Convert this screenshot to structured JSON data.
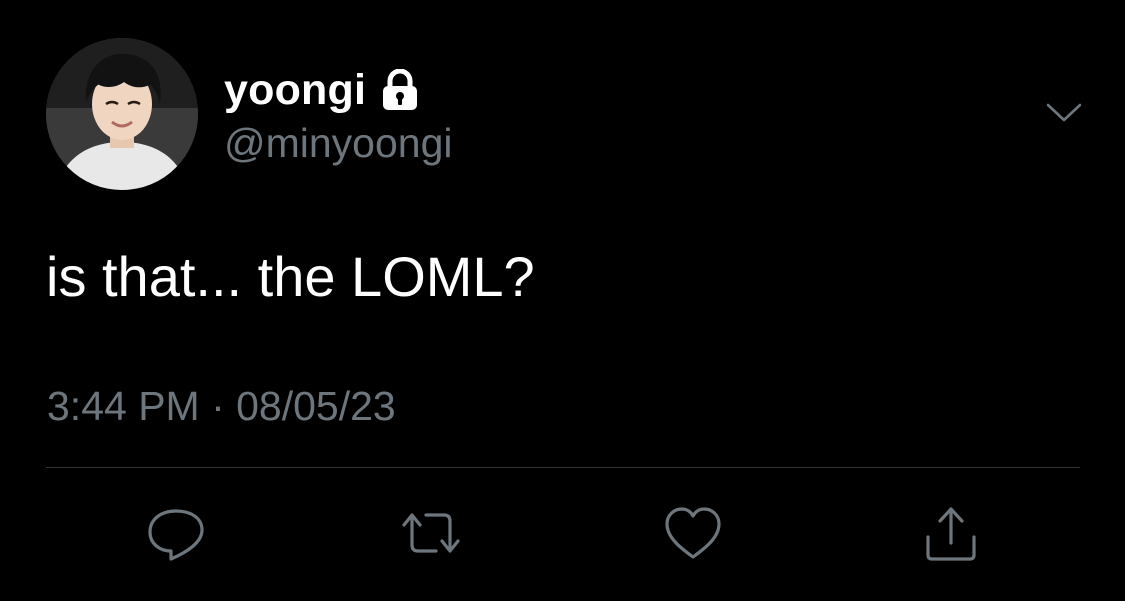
{
  "tweet": {
    "display_name": "yoongi",
    "handle": "@minyoongi",
    "text": "is that... the LOML?",
    "timestamp": "3:44 PM · 08/05/23"
  },
  "icons": {
    "avatar": "profile-photo",
    "lock": "lock-icon",
    "caret": "chevron-down-icon",
    "reply": "reply-icon",
    "retweet": "retweet-icon",
    "like": "heart-icon",
    "share": "share-icon"
  },
  "colors": {
    "background": "#000000",
    "primary_text": "#ffffff",
    "secondary_text": "#6e767d",
    "icon": "#6e767d",
    "divider": "#2f3336"
  }
}
